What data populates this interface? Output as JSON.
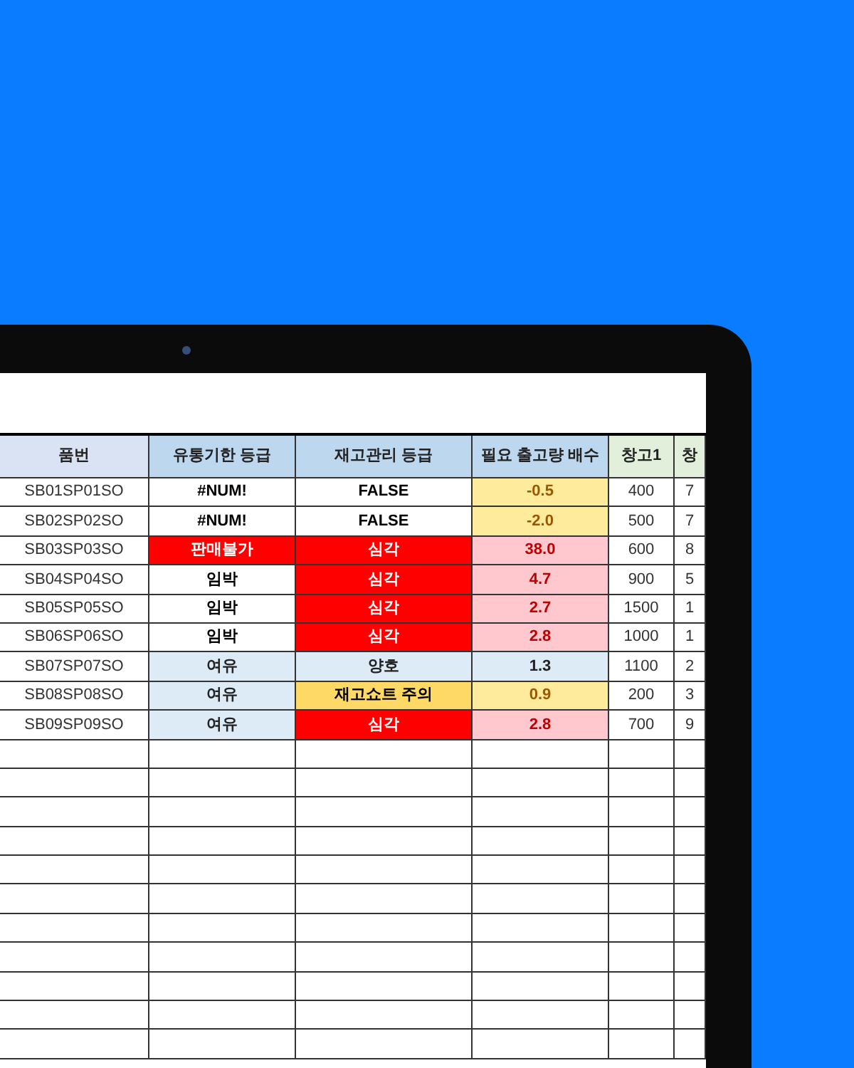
{
  "table": {
    "columns": [
      {
        "label": "품번",
        "kind": "id"
      },
      {
        "label": "유통기한 등급",
        "kind": "grade"
      },
      {
        "label": "재고관리 등급",
        "kind": "grade"
      },
      {
        "label": "필요 출고량 배수",
        "kind": "grade"
      },
      {
        "label": "창고1",
        "kind": "stock"
      },
      {
        "label": "창",
        "kind": "stock"
      }
    ],
    "rows": [
      {
        "cells": [
          {
            "text": "SB01SP01SO",
            "kind": "plain"
          },
          {
            "text": "#NUM!",
            "kind": "bold"
          },
          {
            "text": "FALSE",
            "kind": "bold"
          },
          {
            "text": "-0.5",
            "kind": "yellow"
          },
          {
            "text": "400",
            "kind": "plain"
          },
          {
            "text": "7",
            "kind": "plain"
          }
        ]
      },
      {
        "cells": [
          {
            "text": "SB02SP02SO",
            "kind": "plain"
          },
          {
            "text": "#NUM!",
            "kind": "bold"
          },
          {
            "text": "FALSE",
            "kind": "bold"
          },
          {
            "text": "-2.0",
            "kind": "yellow"
          },
          {
            "text": "500",
            "kind": "plain"
          },
          {
            "text": "7",
            "kind": "plain"
          }
        ]
      },
      {
        "cells": [
          {
            "text": "SB03SP03SO",
            "kind": "plain"
          },
          {
            "text": "판매불가",
            "kind": "red"
          },
          {
            "text": "심각",
            "kind": "red"
          },
          {
            "text": "38.0",
            "kind": "pink"
          },
          {
            "text": "600",
            "kind": "plain"
          },
          {
            "text": "8",
            "kind": "plain"
          }
        ]
      },
      {
        "cells": [
          {
            "text": "SB04SP04SO",
            "kind": "plain"
          },
          {
            "text": "임박",
            "kind": "bold"
          },
          {
            "text": "심각",
            "kind": "red"
          },
          {
            "text": "4.7",
            "kind": "pink"
          },
          {
            "text": "900",
            "kind": "plain"
          },
          {
            "text": "5",
            "kind": "plain"
          }
        ]
      },
      {
        "cells": [
          {
            "text": "SB05SP05SO",
            "kind": "plain"
          },
          {
            "text": "임박",
            "kind": "bold"
          },
          {
            "text": "심각",
            "kind": "red"
          },
          {
            "text": "2.7",
            "kind": "pink"
          },
          {
            "text": "1500",
            "kind": "plain"
          },
          {
            "text": "1",
            "kind": "plain"
          }
        ]
      },
      {
        "cells": [
          {
            "text": "SB06SP06SO",
            "kind": "plain"
          },
          {
            "text": "임박",
            "kind": "bold"
          },
          {
            "text": "심각",
            "kind": "red"
          },
          {
            "text": "2.8",
            "kind": "pink"
          },
          {
            "text": "1000",
            "kind": "plain"
          },
          {
            "text": "1",
            "kind": "plain"
          }
        ]
      },
      {
        "cells": [
          {
            "text": "SB07SP07SO",
            "kind": "plain"
          },
          {
            "text": "여유",
            "kind": "blue"
          },
          {
            "text": "양호",
            "kind": "blue"
          },
          {
            "text": "1.3",
            "kind": "blue"
          },
          {
            "text": "1100",
            "kind": "plain"
          },
          {
            "text": "2",
            "kind": "plain"
          }
        ]
      },
      {
        "cells": [
          {
            "text": "SB08SP08SO",
            "kind": "plain"
          },
          {
            "text": "여유",
            "kind": "blue"
          },
          {
            "text": "재고쇼트 주의",
            "kind": "orange"
          },
          {
            "text": "0.9",
            "kind": "yellow"
          },
          {
            "text": "200",
            "kind": "plain"
          },
          {
            "text": "3",
            "kind": "plain"
          }
        ]
      },
      {
        "cells": [
          {
            "text": "SB09SP09SO",
            "kind": "plain"
          },
          {
            "text": "여유",
            "kind": "blue"
          },
          {
            "text": "심각",
            "kind": "red"
          },
          {
            "text": "2.8",
            "kind": "pink"
          },
          {
            "text": "700",
            "kind": "plain"
          },
          {
            "text": "9",
            "kind": "plain"
          }
        ]
      }
    ]
  }
}
